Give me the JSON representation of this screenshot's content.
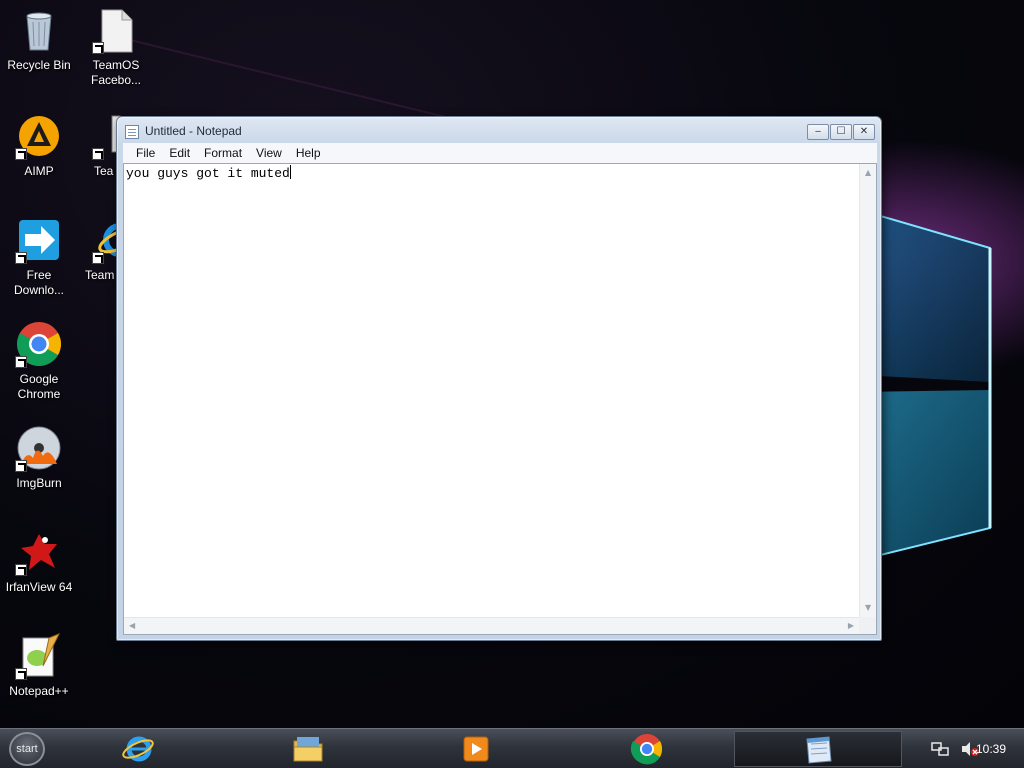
{
  "desktop": {
    "icons": [
      {
        "label": "Recycle Bin",
        "icon": "recycle-bin-icon"
      },
      {
        "label": "TeamOS Facebo...",
        "icon": "file-icon"
      },
      {
        "label": "AIMP",
        "icon": "aimp-icon"
      },
      {
        "label": "Tea",
        "icon": "teamos-icon"
      },
      {
        "label": "Free Downlo...",
        "icon": "free-download-manager-icon"
      },
      {
        "label": "Team",
        "icon": "internet-explorer-icon"
      },
      {
        "label": "Google Chrome",
        "icon": "chrome-icon"
      },
      {
        "label": "ImgBurn",
        "icon": "imgburn-icon"
      },
      {
        "label": "IrfanView 64",
        "icon": "irfanview-icon"
      },
      {
        "label": "Notepad++",
        "icon": "notepad-plus-plus-icon"
      }
    ]
  },
  "notepad": {
    "title": "Untitled - Notepad",
    "controls": {
      "minimize": "‒",
      "maximize": "☐",
      "close": "✕"
    },
    "menu": [
      "File",
      "Edit",
      "Format",
      "View",
      "Help"
    ],
    "content": "you guys got it muted"
  },
  "taskbar": {
    "start_label": "start",
    "pinned": [
      {
        "name": "internet-explorer",
        "icon": "internet-explorer-icon"
      },
      {
        "name": "file-explorer",
        "icon": "folder-icon"
      },
      {
        "name": "media-player",
        "icon": "media-player-icon"
      },
      {
        "name": "google-chrome",
        "icon": "chrome-icon"
      }
    ],
    "active_window_icon": "notepad-icon",
    "tray": {
      "network_icon": "network-icon",
      "volume_icon": "volume-muted-icon"
    },
    "clock": "10:39"
  },
  "colors": {
    "wallpaper_glow": "#2ec5ff",
    "wallpaper_pink": "#e64bd0",
    "taskbar": "#2f333b"
  }
}
